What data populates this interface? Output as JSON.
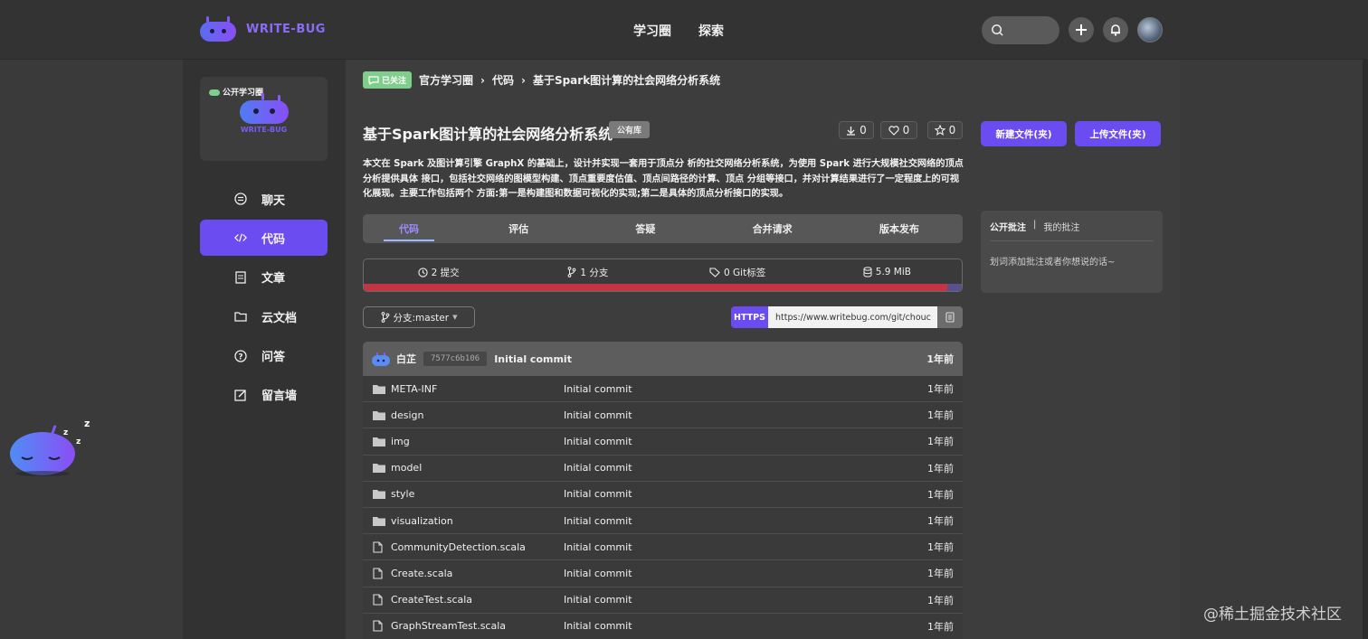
{
  "brand": {
    "name": "WRITE-BUG"
  },
  "topnav": {
    "items": [
      "学习圈",
      "探索"
    ]
  },
  "circle": {
    "tag": "公开学习圈",
    "logo_text": "WRITE-BUG"
  },
  "sidebar": {
    "items": [
      {
        "label": "聊天",
        "icon": "chat-icon"
      },
      {
        "label": "代码",
        "icon": "code-icon",
        "active": true
      },
      {
        "label": "文章",
        "icon": "article-icon"
      },
      {
        "label": "云文档",
        "icon": "folder-icon"
      },
      {
        "label": "问答",
        "icon": "question-icon"
      },
      {
        "label": "留言墙",
        "icon": "edit-icon"
      }
    ]
  },
  "breadcrumb": {
    "follow": "已关注",
    "parts": [
      "官方学习圈",
      "代码",
      "基于Spark图计算的社会网络分析系统"
    ]
  },
  "repo": {
    "title": "基于Spark图计算的社会网络分析系统",
    "badge": "公有库",
    "downloads": "0",
    "likes": "0",
    "stars": "0",
    "description": "本文在 Spark 及图计算引擎 GraphX 的基础上，设计并实现一套用于顶点分 析的社交网络分析系统，为使用 Spark 进行大规模社交网络的顶点分析提供具体 接口，包括社交网络的图模型构建、顶点重要度估值、顶点间路径的计算、顶点 分组等接口，并对计算结果进行了一定程度上的可视化展现。主要工作包括两个 方面:第一是构建图和数据可视化的实现;第二是具体的顶点分析接口的实现。"
  },
  "tabs": [
    "代码",
    "评估",
    "答疑",
    "合并请求",
    "版本发布"
  ],
  "info": {
    "commits": "2 提交",
    "branches": "1 分支",
    "tags": "0 Git标签",
    "size": "5.9 MiB"
  },
  "branch": {
    "label": "分支:master"
  },
  "clone": {
    "protocol": "HTTPS",
    "url": "https://www.writebug.com/git/chouc"
  },
  "latest_commit": {
    "author": "白芷",
    "sha": "7577c6b106",
    "message": "Initial commit",
    "time": "1年前"
  },
  "files": [
    {
      "type": "folder",
      "name": "META-INF",
      "message": "Initial commit",
      "time": "1年前"
    },
    {
      "type": "folder",
      "name": "design",
      "message": "Initial commit",
      "time": "1年前"
    },
    {
      "type": "folder",
      "name": "img",
      "message": "Initial commit",
      "time": "1年前"
    },
    {
      "type": "folder",
      "name": "model",
      "message": "Initial commit",
      "time": "1年前"
    },
    {
      "type": "folder",
      "name": "style",
      "message": "Initial commit",
      "time": "1年前"
    },
    {
      "type": "folder",
      "name": "visualization",
      "message": "Initial commit",
      "time": "1年前"
    },
    {
      "type": "file",
      "name": "CommunityDetection.scala",
      "message": "Initial commit",
      "time": "1年前"
    },
    {
      "type": "file",
      "name": "Create.scala",
      "message": "Initial commit",
      "time": "1年前"
    },
    {
      "type": "file",
      "name": "CreateTest.scala",
      "message": "Initial commit",
      "time": "1年前"
    },
    {
      "type": "file",
      "name": "GraphStreamTest.scala",
      "message": "Initial commit",
      "time": "1年前"
    }
  ],
  "actions": {
    "new_folder": "新建文件(夹)",
    "upload": "上传文件(夹)"
  },
  "annotations": {
    "tab_public": "公开批注",
    "separator": "|",
    "tab_mine": "我的批注",
    "placeholder": "划词添加批注或者你想说的话~"
  },
  "watermark": "@稀土掘金技术社区",
  "sleep_marks": [
    "z",
    "z",
    "z"
  ]
}
